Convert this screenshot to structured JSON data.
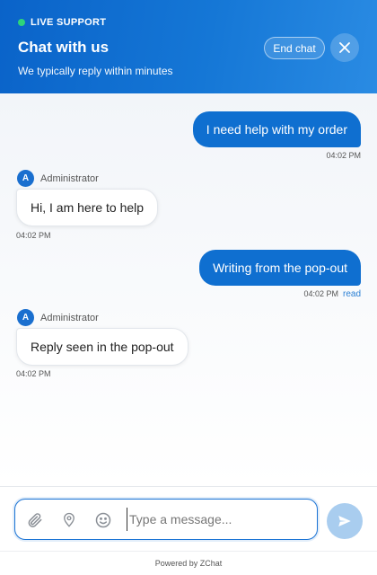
{
  "header": {
    "live_label": "LIVE SUPPORT",
    "title": "Chat with us",
    "subtitle": "We typically reply within minutes",
    "end_chat_label": "End chat",
    "close_icon": "close-icon",
    "live_color": "#2ed47a",
    "brand_color": "#0f6fd0"
  },
  "messages": [
    {
      "direction": "out",
      "text": "I need help with my order",
      "time": "04:02 PM"
    },
    {
      "direction": "in",
      "sender": "Administrator",
      "avatar_initial": "A",
      "text": "Hi, I am here to help",
      "time": "04:02 PM"
    },
    {
      "direction": "out",
      "text": "Writing from the pop-out",
      "time": "04:02 PM",
      "status": "read"
    },
    {
      "direction": "in",
      "sender": "Administrator",
      "avatar_initial": "A",
      "text": "Reply seen in the pop-out",
      "time": "04:02 PM"
    }
  ],
  "composer": {
    "placeholder": "Type a message...",
    "value": "",
    "icons": [
      "paperclip-icon",
      "location-pin-icon",
      "emoji-icon",
      "send-icon"
    ]
  },
  "footer": {
    "text": "Powered by ZChat"
  }
}
